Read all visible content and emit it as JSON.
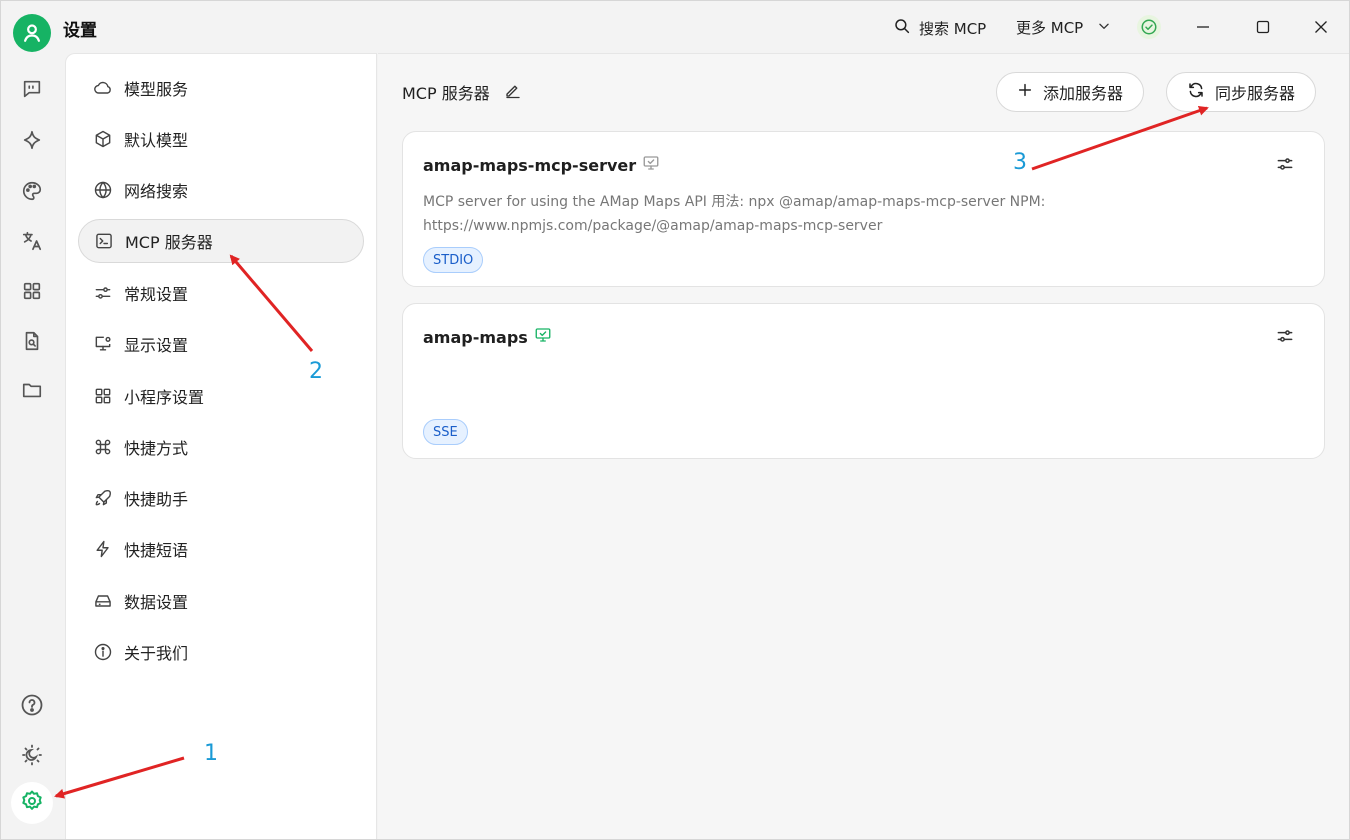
{
  "app": {
    "title": "设置"
  },
  "titlebar": {
    "search_label": "搜索 MCP",
    "more_label": "更多 MCP"
  },
  "nav": {
    "items": [
      {
        "label": "模型服务",
        "icon": "cloud-icon"
      },
      {
        "label": "默认模型",
        "icon": "cube-icon"
      },
      {
        "label": "网络搜索",
        "icon": "globe-icon"
      },
      {
        "label": "MCP 服务器",
        "icon": "terminal-icon",
        "active": true
      },
      {
        "label": "常规设置",
        "icon": "sliders-icon"
      },
      {
        "label": "显示设置",
        "icon": "monitor-gear-icon"
      },
      {
        "label": "小程序设置",
        "icon": "grid-icon"
      },
      {
        "label": "快捷方式",
        "icon": "command-icon"
      },
      {
        "label": "快捷助手",
        "icon": "rocket-icon"
      },
      {
        "label": "快捷短语",
        "icon": "zap-icon"
      },
      {
        "label": "数据设置",
        "icon": "drive-icon"
      },
      {
        "label": "关于我们",
        "icon": "info-icon"
      }
    ]
  },
  "main": {
    "title": "MCP 服务器",
    "add_label": "添加服务器",
    "sync_label": "同步服务器",
    "servers": [
      {
        "name": "amap-maps-mcp-server",
        "description": "MCP server for using the AMap Maps API 用法: npx @amap/amap-maps-mcp-server NPM: https://www.npmjs.com/package/@amap/amap-maps-mcp-server",
        "type": "STDIO",
        "active": false
      },
      {
        "name": "amap-maps",
        "description": "",
        "type": "SSE",
        "active": true
      }
    ]
  },
  "annotations": [
    "1",
    "2",
    "3"
  ],
  "colors": {
    "brand": "#16b364",
    "annotation_arrow": "#e02424",
    "annotation_number": "#1a9ad6",
    "tag_text": "#1a5ec9"
  }
}
